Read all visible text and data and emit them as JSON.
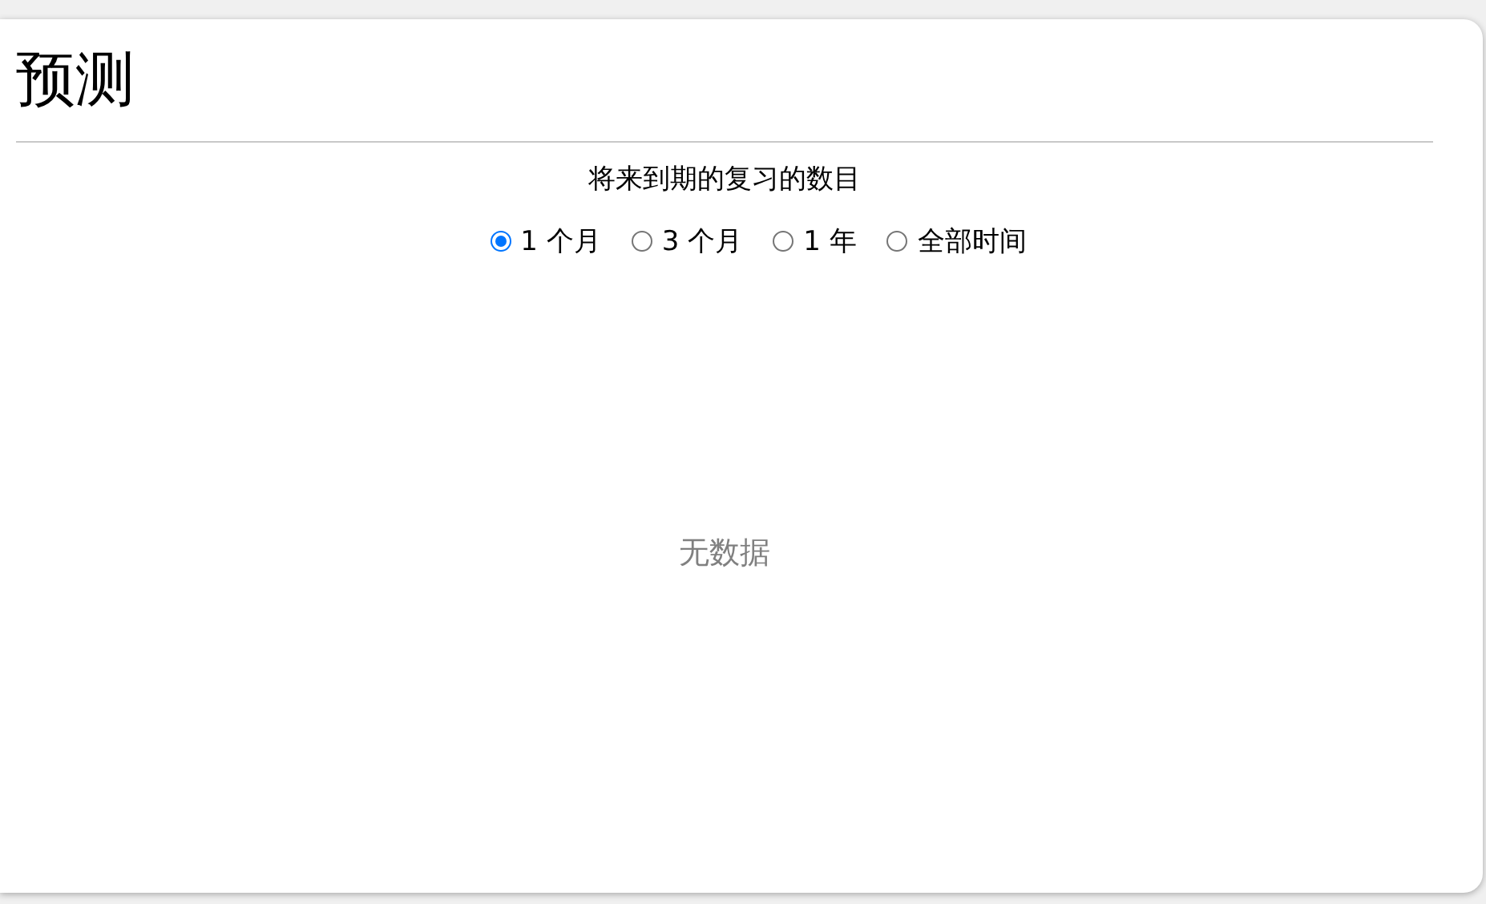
{
  "card": {
    "title": "预测",
    "subtitle": "将来到期的复习的数目",
    "ranges": [
      {
        "label": "1 个月",
        "selected": true
      },
      {
        "label": "3 个月",
        "selected": false
      },
      {
        "label": "1 年",
        "selected": false
      },
      {
        "label": "全部时间",
        "selected": false
      }
    ],
    "empty_message": "无数据"
  }
}
